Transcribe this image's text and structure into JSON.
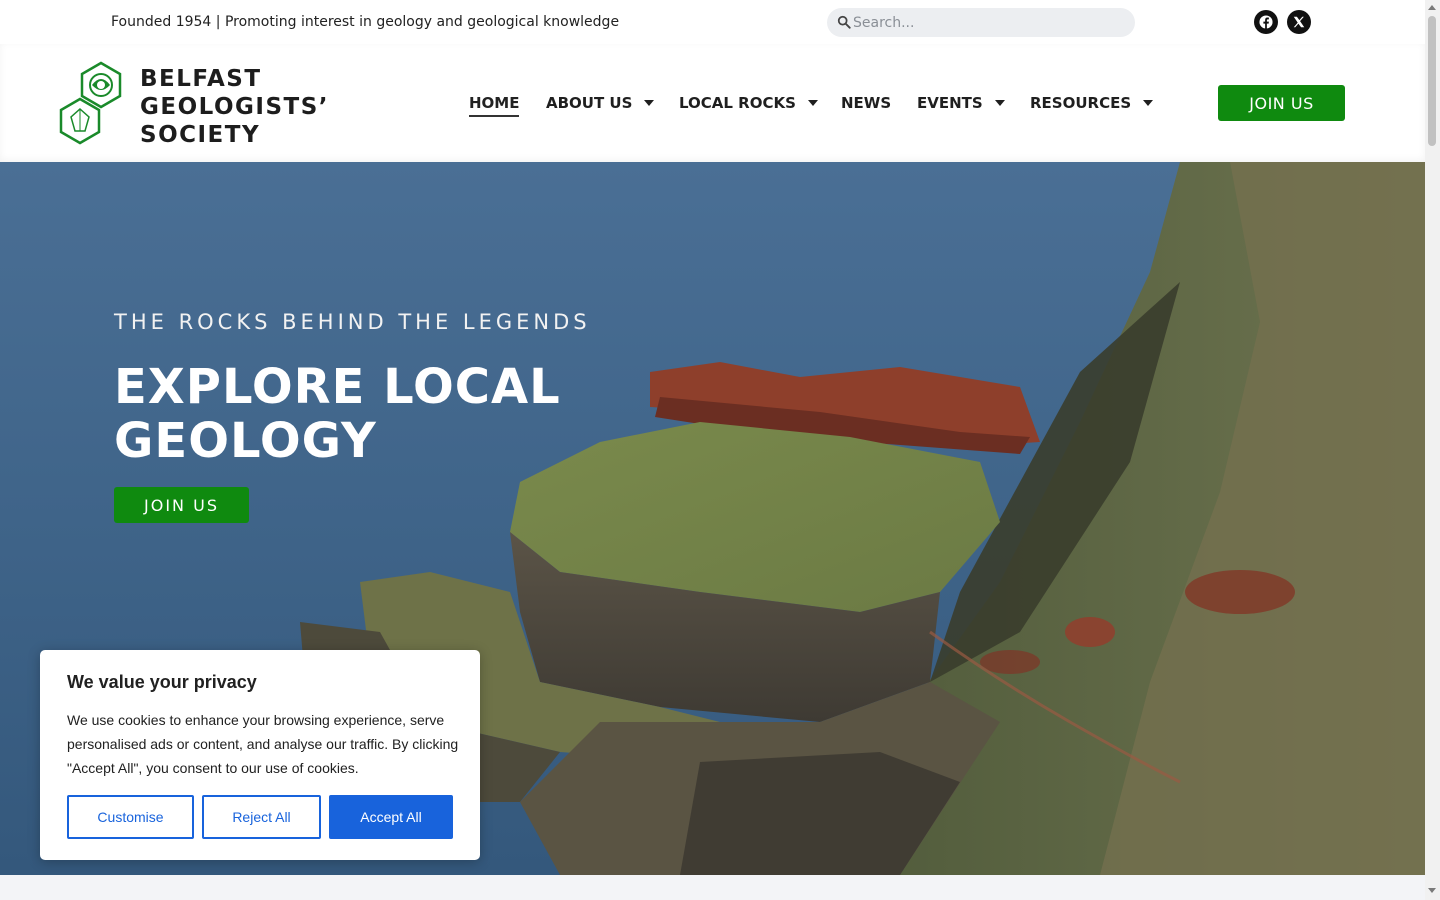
{
  "topbar": {
    "tagline": "Founded 1954 | Promoting interest in geology and geological knowledge",
    "search_placeholder": "Search...",
    "social": [
      "facebook-icon",
      "x-twitter-icon"
    ]
  },
  "header": {
    "logo_lines": [
      "BELFAST",
      "GEOLOGISTS’",
      "SOCIETY"
    ],
    "nav": [
      {
        "label": "HOME",
        "active": true,
        "dropdown": false
      },
      {
        "label": "ABOUT US",
        "active": false,
        "dropdown": true
      },
      {
        "label": "LOCAL ROCKS",
        "active": false,
        "dropdown": true
      },
      {
        "label": "NEWS",
        "active": false,
        "dropdown": false
      },
      {
        "label": "EVENTS",
        "active": false,
        "dropdown": true
      },
      {
        "label": "RESOURCES",
        "active": false,
        "dropdown": true
      }
    ],
    "join_label": "JOIN US"
  },
  "hero": {
    "overline": "THE ROCKS BEHIND THE LEGENDS",
    "headline_1": "EXPLORE LOCAL",
    "headline_2": "GEOLOGY",
    "join_label": "JOIN US"
  },
  "cookie": {
    "title": "We value your privacy",
    "text": "We use cookies to enhance your browsing experience, serve personalised ads or content, and analyse our traffic. By clicking \"Accept All\", you consent to our use of cookies.",
    "customise_label": "Customise",
    "reject_label": "Reject All",
    "accept_label": "Accept All"
  },
  "colors": {
    "brand_green": "#0f8a0f",
    "cookie_blue": "#1863dc"
  }
}
